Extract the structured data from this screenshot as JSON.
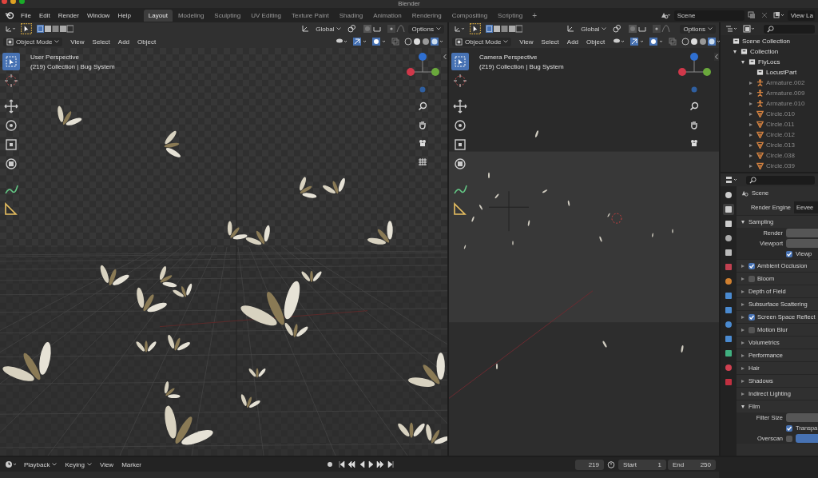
{
  "window": {
    "title": "Blender"
  },
  "menu": [
    "File",
    "Edit",
    "Render",
    "Window",
    "Help"
  ],
  "workspaces": [
    {
      "label": "Layout",
      "selected": true
    },
    {
      "label": "Modeling",
      "selected": false
    },
    {
      "label": "Sculpting",
      "selected": false
    },
    {
      "label": "UV Editing",
      "selected": false
    },
    {
      "label": "Texture Paint",
      "selected": false
    },
    {
      "label": "Shading",
      "selected": false
    },
    {
      "label": "Animation",
      "selected": false
    },
    {
      "label": "Rendering",
      "selected": false
    },
    {
      "label": "Compositing",
      "selected": false
    },
    {
      "label": "Scripting",
      "selected": false
    }
  ],
  "add_workspace": "+",
  "scene": {
    "value": "Scene"
  },
  "view_layer": {
    "value": "View La"
  },
  "viewports": [
    {
      "kind": "perspective",
      "transform": "Global",
      "options": "Options",
      "mode": "Object Mode",
      "menus": [
        "View",
        "Select",
        "Add",
        "Object"
      ],
      "title": "User Perspective",
      "info": "(219) Collection | Bug System"
    },
    {
      "kind": "camera",
      "transform": "Global",
      "options": "Options",
      "mode": "Object Mode",
      "menus": [
        "View",
        "Select",
        "Add",
        "Object"
      ],
      "title": "Camera Perspective",
      "info": "(219) Collection | Bug System"
    }
  ],
  "outliner": {
    "items": [
      {
        "label": "Scene Collection",
        "kind": "collection",
        "children": [
          {
            "label": "Collection",
            "kind": "collection",
            "expanded": true,
            "children": [
              {
                "label": "FlyLocs",
                "kind": "collection",
                "expanded": true,
                "children": [
                  {
                    "label": "LocustPart",
                    "kind": "collection"
                  },
                  {
                    "label": "Armature.002",
                    "kind": "armature",
                    "expanded": false
                  },
                  {
                    "label": "Armature.009",
                    "kind": "armature",
                    "expanded": false
                  },
                  {
                    "label": "Armature.010",
                    "kind": "armature",
                    "expanded": false
                  },
                  {
                    "label": "Circle.010",
                    "kind": "mesh",
                    "expanded": false
                  },
                  {
                    "label": "Circle.011",
                    "kind": "mesh",
                    "expanded": false
                  },
                  {
                    "label": "Circle.012",
                    "kind": "mesh",
                    "expanded": false
                  },
                  {
                    "label": "Circle.013",
                    "kind": "mesh",
                    "expanded": false
                  },
                  {
                    "label": "Circle.038",
                    "kind": "mesh",
                    "expanded": false
                  },
                  {
                    "label": "Circle.039",
                    "kind": "mesh",
                    "expanded": false
                  }
                ]
              }
            ]
          }
        ]
      }
    ]
  },
  "properties": {
    "title": "Scene",
    "render_engine": {
      "label": "Render Engine",
      "value": "Eevee"
    },
    "sections": [
      {
        "label": "Sampling",
        "expanded": true,
        "rows": [
          {
            "kind": "field",
            "label": "Render"
          },
          {
            "kind": "field",
            "label": "Viewport"
          },
          {
            "kind": "checkbox",
            "label": "Viewp",
            "checked": true
          }
        ]
      },
      {
        "label": "Ambient Occlusion",
        "expanded": false,
        "checked": true
      },
      {
        "label": "Bloom",
        "expanded": false,
        "checked": false
      },
      {
        "label": "Depth of Field",
        "expanded": false
      },
      {
        "label": "Subsurface Scattering",
        "expanded": false
      },
      {
        "label": "Screen Space Reflect",
        "expanded": false,
        "checked": true
      },
      {
        "label": "Motion Blur",
        "expanded": false,
        "checked": false
      },
      {
        "label": "Volumetrics",
        "expanded": false
      },
      {
        "label": "Performance",
        "expanded": false
      },
      {
        "label": "Hair",
        "expanded": false
      },
      {
        "label": "Shadows",
        "expanded": false
      },
      {
        "label": "Indirect Lighting",
        "expanded": false
      },
      {
        "label": "Film",
        "expanded": true,
        "rows": [
          {
            "kind": "field",
            "label": "Filter Size"
          },
          {
            "kind": "checkbox",
            "label": "Transpa",
            "checked": true
          },
          {
            "kind": "toggle-field",
            "label": "Overscan",
            "checked": false
          }
        ]
      }
    ]
  },
  "timeline": {
    "menus": [
      {
        "label": "Playback",
        "dropdown": true
      },
      {
        "label": "Keying",
        "dropdown": true
      },
      {
        "label": "View",
        "dropdown": false
      },
      {
        "label": "Marker",
        "dropdown": false
      }
    ],
    "frame": "219",
    "start_label": "Start",
    "start": "1",
    "end_label": "End",
    "end": "250"
  }
}
